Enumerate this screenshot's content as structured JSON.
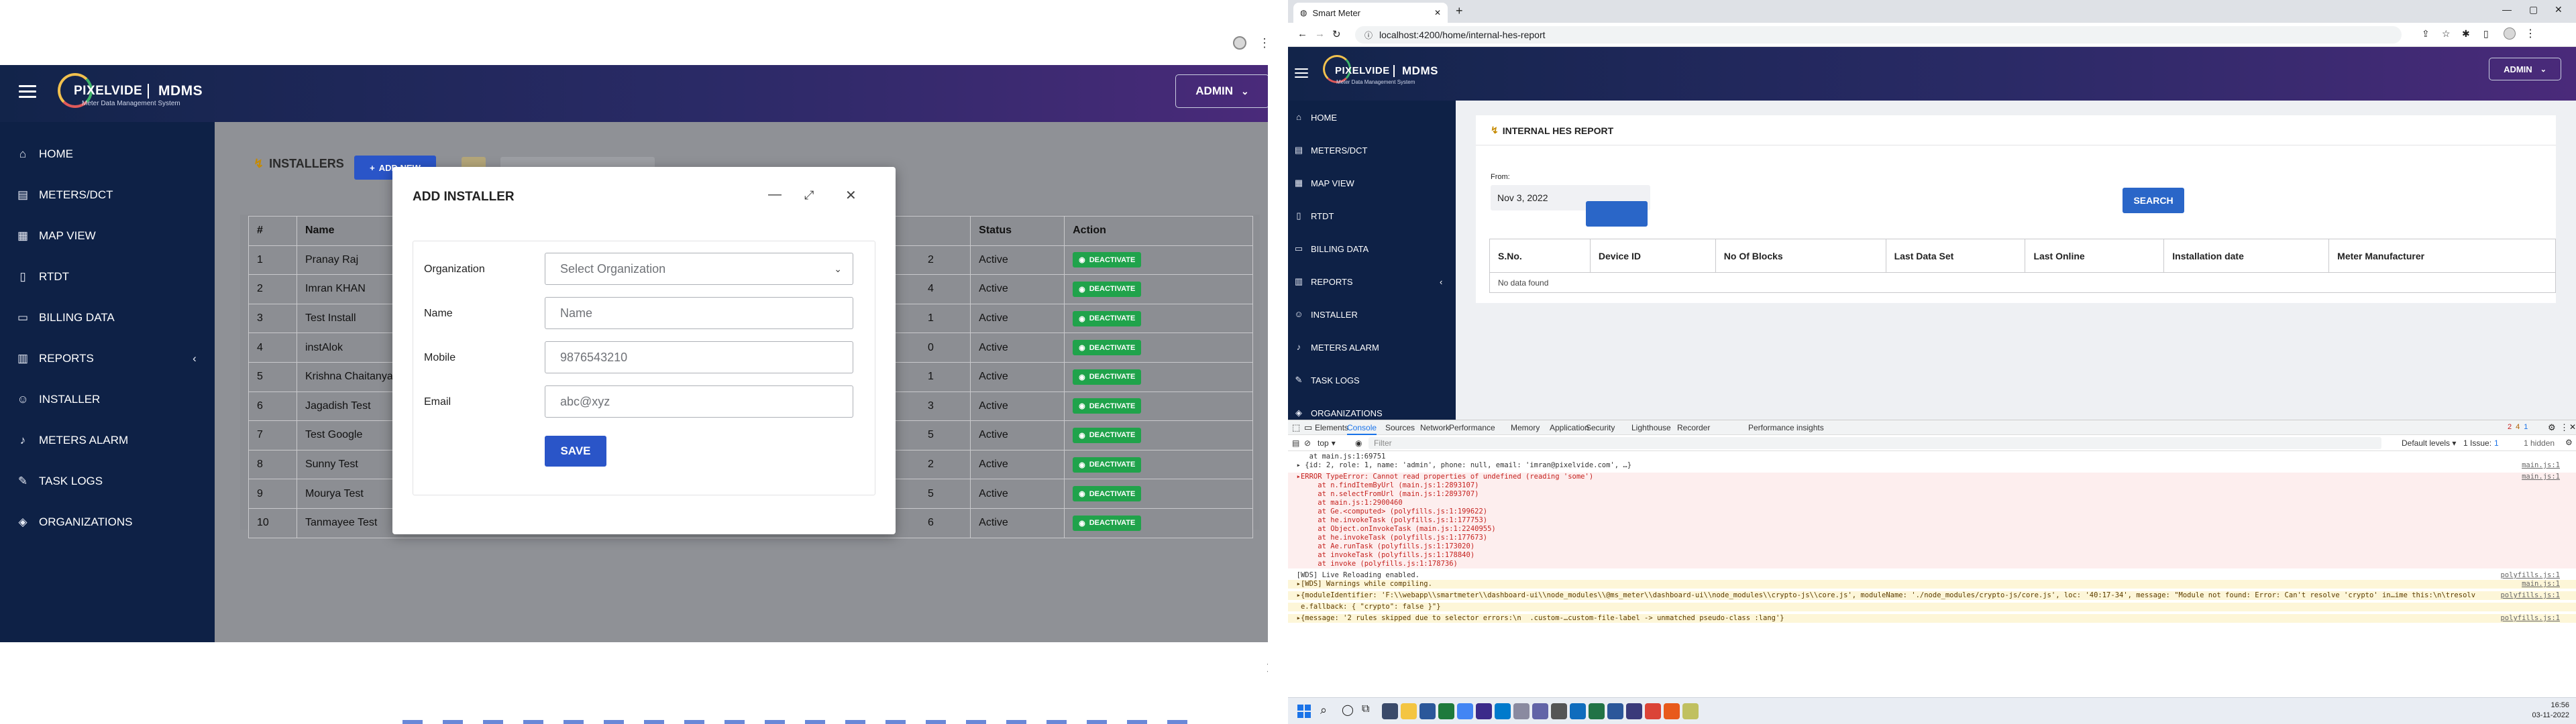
{
  "left": {
    "header": {
      "brand": "PIXELVIDE",
      "product": "MDMS",
      "tagline": "Meter Data Management System",
      "admin_label": "ADMIN"
    },
    "sidebar": {
      "items": [
        {
          "label": "HOME",
          "icon": "home-icon"
        },
        {
          "label": "METERS/DCT",
          "icon": "meter-icon"
        },
        {
          "label": "MAP VIEW",
          "icon": "map-icon"
        },
        {
          "label": "RTDT",
          "icon": "document-icon"
        },
        {
          "label": "BILLING DATA",
          "icon": "billing-icon"
        },
        {
          "label": "REPORTS",
          "icon": "reports-icon"
        },
        {
          "label": "INSTALLER",
          "icon": "installer-icon"
        },
        {
          "label": "METERS ALARM",
          "icon": "alarm-icon"
        },
        {
          "label": "TASK LOGS",
          "icon": "tasklog-icon"
        },
        {
          "label": "ORGANIZATIONS",
          "icon": "organization-icon"
        }
      ]
    },
    "page": {
      "title": "INSTALLERS",
      "add_button": "ADD NEW"
    },
    "table": {
      "columns": [
        "#",
        "Name",
        "Status",
        "Action"
      ],
      "rows": [
        {
          "num": "1",
          "name": "Pranay Raj",
          "mobile_tail": "2",
          "status": "Active",
          "action": "DEACTIVATE"
        },
        {
          "num": "2",
          "name": "Imran KHAN",
          "mobile_tail": "4",
          "status": "Active",
          "action": "DEACTIVATE"
        },
        {
          "num": "3",
          "name": "Test Install",
          "mobile_tail": "1",
          "status": "Active",
          "action": "DEACTIVATE"
        },
        {
          "num": "4",
          "name": "instAlok",
          "mobile_tail": "0",
          "status": "Active",
          "action": "DEACTIVATE"
        },
        {
          "num": "5",
          "name": "Krishna Chaitanya",
          "mobile_tail": "1",
          "status": "Active",
          "action": "DEACTIVATE"
        },
        {
          "num": "6",
          "name": "Jagadish Test",
          "mobile_tail": "3",
          "status": "Active",
          "action": "DEACTIVATE"
        },
        {
          "num": "7",
          "name": "Test Google",
          "mobile_tail": "5",
          "status": "Active",
          "action": "DEACTIVATE"
        },
        {
          "num": "8",
          "name": "Sunny Test",
          "mobile_tail": "2",
          "status": "Active",
          "action": "DEACTIVATE"
        },
        {
          "num": "9",
          "name": "Mourya Test",
          "mobile_tail": "5",
          "status": "Active",
          "action": "DEACTIVATE"
        },
        {
          "num": "10",
          "name": "Tanmayee Test",
          "mobile_tail": "6",
          "status": "Active",
          "action": "DEACTIVATE"
        }
      ]
    },
    "modal": {
      "title": "ADD INSTALLER",
      "fields": {
        "organization": {
          "label": "Organization",
          "placeholder": "Select Organization"
        },
        "name": {
          "label": "Name",
          "placeholder": "Name"
        },
        "mobile": {
          "label": "Mobile",
          "placeholder": "9876543210"
        },
        "email": {
          "label": "Email",
          "placeholder": "abc@xyz"
        }
      },
      "save_label": "SAVE"
    }
  },
  "right": {
    "browser": {
      "tab_title": "Smart Meter",
      "url": "localhost:4200/home/internal-hes-report"
    },
    "header": {
      "brand": "PIXELVIDE",
      "product": "MDMS",
      "tagline": "Meter Data Management System",
      "admin_label": "ADMIN"
    },
    "sidebar": {
      "items": [
        {
          "label": "HOME",
          "icon": "home-icon"
        },
        {
          "label": "METERS/DCT",
          "icon": "meter-icon"
        },
        {
          "label": "MAP VIEW",
          "icon": "map-icon"
        },
        {
          "label": "RTDT",
          "icon": "document-icon"
        },
        {
          "label": "BILLING DATA",
          "icon": "billing-icon"
        },
        {
          "label": "REPORTS",
          "icon": "reports-icon"
        },
        {
          "label": "INSTALLER",
          "icon": "installer-icon"
        },
        {
          "label": "METERS ALARM",
          "icon": "alarm-icon"
        },
        {
          "label": "TASK LOGS",
          "icon": "tasklog-icon"
        },
        {
          "label": "ORGANIZATIONS",
          "icon": "organization-icon"
        }
      ]
    },
    "report": {
      "title": "INTERNAL HES REPORT",
      "from_label": "From:",
      "from_value": "Nov 3, 2022",
      "search_label": "SEARCH",
      "columns": [
        "S.No.",
        "Device ID",
        "No Of Blocks",
        "Last Data Set",
        "Last Online",
        "Installation date",
        "Meter Manufacturer"
      ],
      "empty_text": "No data found"
    },
    "devtools": {
      "tabs": [
        "Elements",
        "Console",
        "Sources",
        "Network",
        "Performance",
        "Memory",
        "Application",
        "Security",
        "Lighthouse",
        "Recorder",
        "Performance insights"
      ],
      "top_context": "top",
      "filter_placeholder": "Filter",
      "levels_label": "Default levels",
      "issues_label": "1 Issue:",
      "issues_count": "1",
      "hidden_label": "1 hidden",
      "badges": {
        "errors": "2",
        "warnings": "4",
        "info": "1"
      },
      "logs": [
        {
          "type": "info",
          "text": "     at main.js:1:69751",
          "src": ""
        },
        {
          "type": "info",
          "text": "  ▸ {id: 2, role: 1, name: 'admin', phone: null, email: 'imran@pixelvide.com', …}",
          "src": "main.js:1"
        },
        {
          "type": "error",
          "text": "  ▸ERROR TypeError: Cannot read properties of undefined (reading 'some')",
          "src": "main.js:1"
        },
        {
          "type": "error",
          "text": "       at n.findItemByUrl (main.js:1:2893107)",
          "src": ""
        },
        {
          "type": "error",
          "text": "       at n.selectFromUrl (main.js:1:2893707)",
          "src": ""
        },
        {
          "type": "error",
          "text": "       at main.js:1:2900460",
          "src": ""
        },
        {
          "type": "error",
          "text": "       at Ge.<computed> (polyfills.js:1:199622)",
          "src": ""
        },
        {
          "type": "error",
          "text": "       at he.invokeTask (polyfills.js:1:177753)",
          "src": ""
        },
        {
          "type": "error",
          "text": "       at Object.onInvokeTask (main.js:1:2240955)",
          "src": ""
        },
        {
          "type": "error",
          "text": "       at he.invokeTask (polyfills.js:1:177673)",
          "src": ""
        },
        {
          "type": "error",
          "text": "       at Ae.runTask (polyfills.js:1:173020)",
          "src": ""
        },
        {
          "type": "error",
          "text": "       at invokeTask (polyfills.js:1:178840)",
          "src": ""
        },
        {
          "type": "error",
          "text": "       at invoke (polyfills.js:1:178736)",
          "src": ""
        },
        {
          "type": "info",
          "text": "  [WDS] Live Reloading enabled.",
          "src": "polyfills.js:1"
        },
        {
          "type": "warn",
          "text": "  ▸[WDS] Warnings while compiling.",
          "src": "main.js:1"
        },
        {
          "type": "warn",
          "text": "  ▸{moduleIdentifier: 'F:\\\\webapp\\\\smartmeter\\\\dashboard-ui\\\\node_modules\\\\@ms_meter\\\\dashboard-ui\\\\node_modules\\\\crypto-js\\\\core.js', moduleName: './node_modules/crypto-js/core.js', loc: '40:17-34', message: \"Module not found: Error: Can't resolve 'crypto' in…ime this:\\n\\tresolv",
          "src": "polyfills.js:1"
        },
        {
          "type": "warn",
          "text": "   e.fallback: { \"crypto\": false }\"}",
          "src": ""
        },
        {
          "type": "warn",
          "text": "  ▸{message: '2 rules skipped due to selector errors:\\n  .custom-…custom-file-label -> unmatched pseudo-class :lang'}",
          "src": "polyfills.js:1"
        }
      ]
    },
    "taskbar": {
      "time": "16:56",
      "date": "03-11-2022"
    }
  }
}
